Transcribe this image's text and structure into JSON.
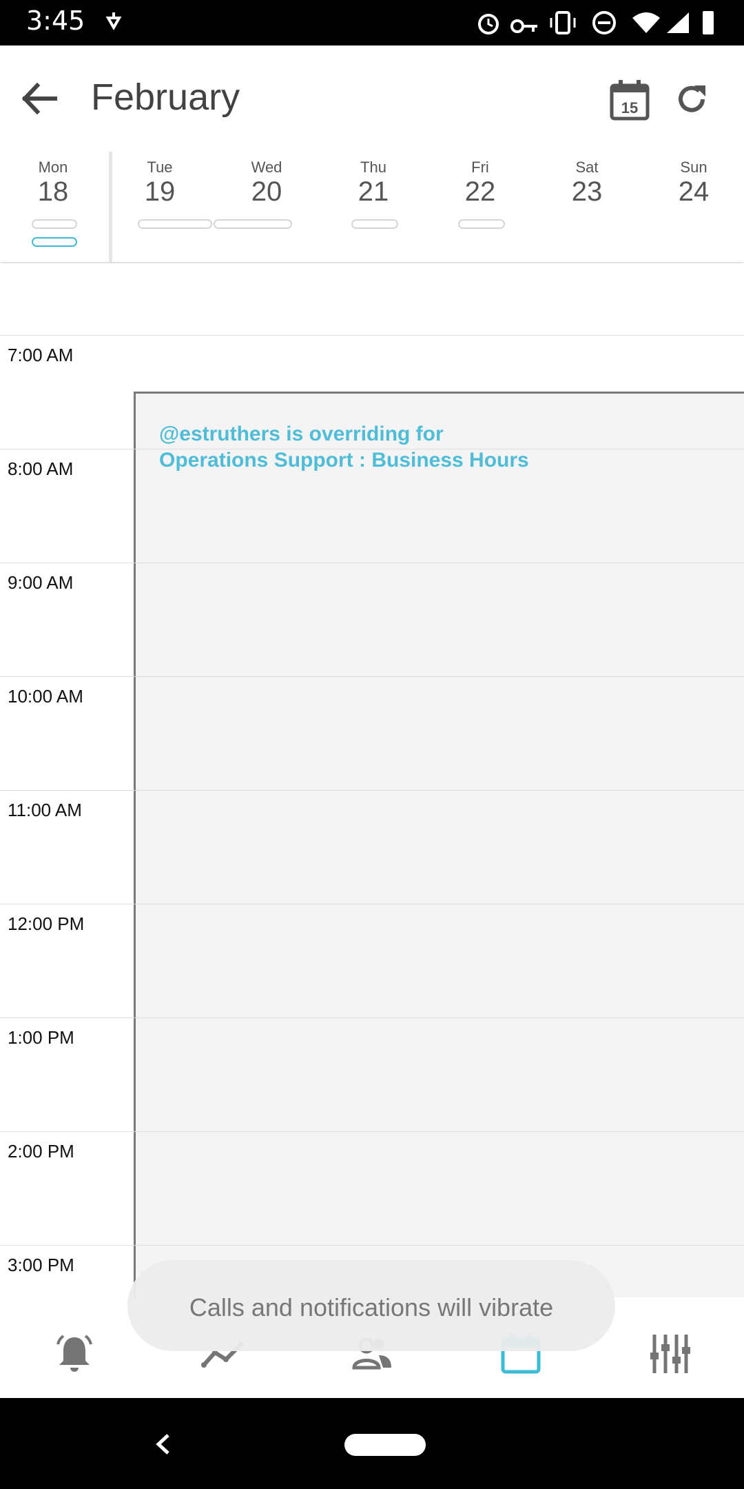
{
  "status_bar": {
    "time": "3:45"
  },
  "header": {
    "title": "February"
  },
  "week": [
    {
      "name": "Mon",
      "date": "18"
    },
    {
      "name": "Tue",
      "date": "19"
    },
    {
      "name": "Wed",
      "date": "20"
    },
    {
      "name": "Thu",
      "date": "21"
    },
    {
      "name": "Fri",
      "date": "22"
    },
    {
      "name": "Sat",
      "date": "23"
    },
    {
      "name": "Sun",
      "date": "24"
    }
  ],
  "times": [
    "7:00 AM",
    "8:00 AM",
    "9:00 AM",
    "10:00 AM",
    "11:00 AM",
    "12:00 PM",
    "1:00 PM",
    "2:00 PM",
    "3:00 PM"
  ],
  "event": {
    "line1": "@estruthers is overriding for",
    "line2": "Operations Support : Business Hours"
  },
  "toast": {
    "text": "Calls and notifications will vibrate"
  },
  "colors": {
    "accent": "#3bbbd8",
    "event_text": "#4fbcd8"
  },
  "nav_icons": [
    "bell-icon",
    "trend-icon",
    "people-icon",
    "calendar-icon",
    "equalizer-icon"
  ]
}
